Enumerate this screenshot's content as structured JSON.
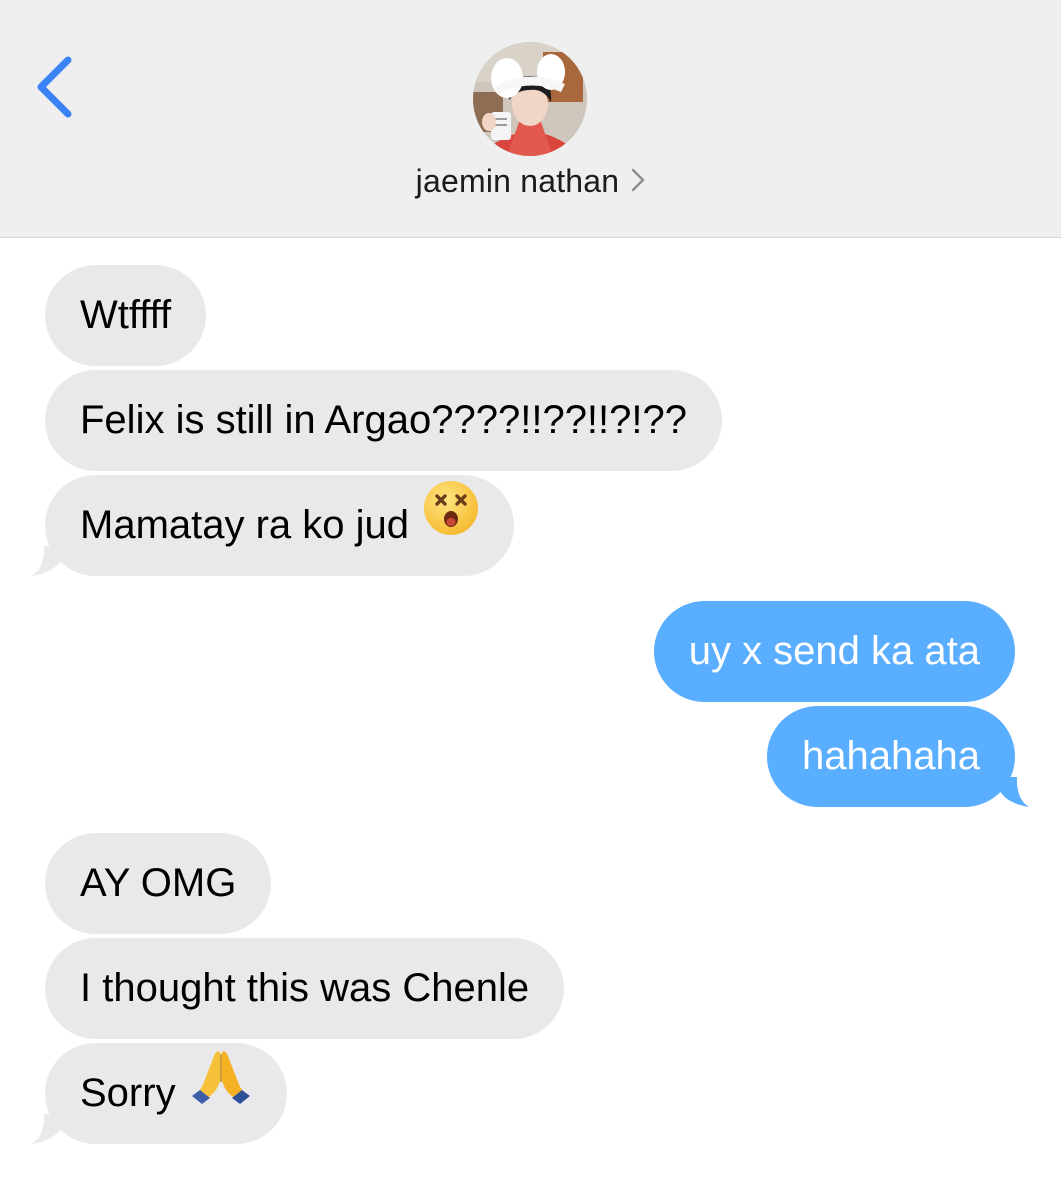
{
  "contact": {
    "name": "jaemin nathan"
  },
  "colors": {
    "header_bg": "#efeff0",
    "accent": "#3b82f6",
    "incoming_bubble": "#e9e9eb",
    "outgoing_bubble": "#5aaeff"
  },
  "icons": {
    "back": "chevron-left-icon",
    "contact_details": "chevron-right-icon",
    "emoji_dizzy": "dizzy-face-emoji",
    "emoji_pray": "folded-hands-emoji"
  },
  "messages": [
    {
      "sender": "contact",
      "text": "Wtffff"
    },
    {
      "sender": "contact",
      "text": "Felix is still in Argao????!!??!!?!??"
    },
    {
      "sender": "contact",
      "text": "Mamatay ra ko jud",
      "emoji": "dizzy-face-emoji"
    },
    {
      "sender": "me",
      "text": "uy x send ka ata"
    },
    {
      "sender": "me",
      "text": "hahahaha"
    },
    {
      "sender": "contact",
      "text": "AY OMG"
    },
    {
      "sender": "contact",
      "text": "I thought this was Chenle"
    },
    {
      "sender": "contact",
      "text": "Sorry",
      "emoji": "folded-hands-emoji"
    }
  ]
}
